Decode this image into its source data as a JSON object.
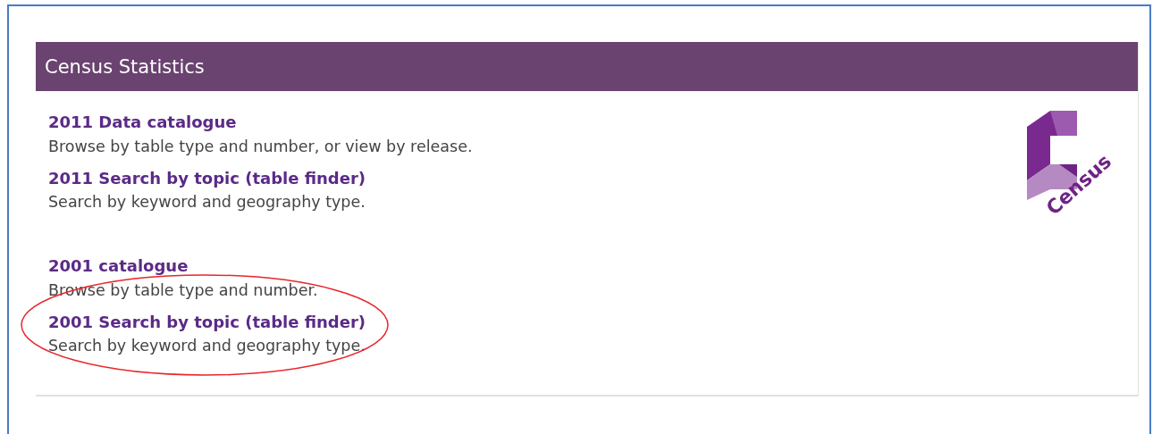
{
  "panel": {
    "title": "Census Statistics",
    "groups": [
      {
        "links": [
          {
            "label": "2011 Data catalogue",
            "description": "Browse by table type and number, or view by release.",
            "highlighted": false
          },
          {
            "label": "2011 Search by topic (table finder)",
            "description": "Search by keyword and geography type.",
            "highlighted": false
          }
        ]
      },
      {
        "links": [
          {
            "label": "2001 catalogue",
            "description": "Browse by table type and number.",
            "highlighted": false
          },
          {
            "label": "2001 Search by topic (table finder)",
            "description": "Search by keyword and geography type.",
            "highlighted": true
          }
        ]
      }
    ],
    "logo": {
      "text": "Census"
    }
  }
}
